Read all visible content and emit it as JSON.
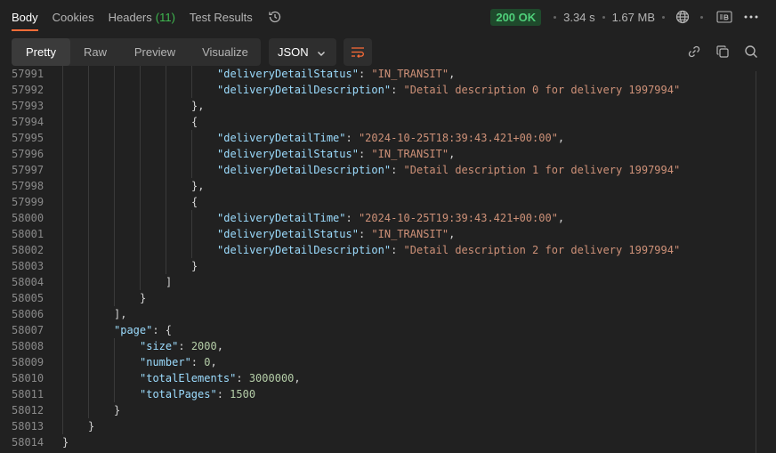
{
  "tabs": [
    {
      "label": "Body",
      "active": true
    },
    {
      "label": "Cookies",
      "active": false
    },
    {
      "label": "Headers",
      "count": "(11)",
      "active": false
    },
    {
      "label": "Test Results",
      "active": false
    }
  ],
  "status": {
    "code": "200 OK",
    "time": "3.34 s",
    "size": "1.67 MB"
  },
  "view_modes": [
    "Pretty",
    "Raw",
    "Preview",
    "Visualize"
  ],
  "format": "JSON",
  "colors": {
    "accent": "#ff6c37",
    "ok": "#4fd07a",
    "key": "#9cdcfe",
    "string": "#ce9178",
    "number": "#b5cea8"
  },
  "lines": [
    {
      "n": "57991",
      "indent": 6,
      "parts": [
        [
          "k",
          "\"deliveryDetailStatus\""
        ],
        [
          "p",
          ": "
        ],
        [
          "s",
          "\"IN_TRANSIT\""
        ],
        [
          "p",
          ","
        ]
      ]
    },
    {
      "n": "57992",
      "indent": 6,
      "parts": [
        [
          "k",
          "\"deliveryDetailDescription\""
        ],
        [
          "p",
          ": "
        ],
        [
          "s",
          "\"Detail description 0 for delivery 1997994\""
        ]
      ]
    },
    {
      "n": "57993",
      "indent": 5,
      "parts": [
        [
          "p",
          "},"
        ]
      ]
    },
    {
      "n": "57994",
      "indent": 5,
      "parts": [
        [
          "p",
          "{"
        ]
      ]
    },
    {
      "n": "57995",
      "indent": 6,
      "parts": [
        [
          "k",
          "\"deliveryDetailTime\""
        ],
        [
          "p",
          ": "
        ],
        [
          "s",
          "\"2024-10-25T18:39:43.421+00:00\""
        ],
        [
          "p",
          ","
        ]
      ]
    },
    {
      "n": "57996",
      "indent": 6,
      "parts": [
        [
          "k",
          "\"deliveryDetailStatus\""
        ],
        [
          "p",
          ": "
        ],
        [
          "s",
          "\"IN_TRANSIT\""
        ],
        [
          "p",
          ","
        ]
      ]
    },
    {
      "n": "57997",
      "indent": 6,
      "parts": [
        [
          "k",
          "\"deliveryDetailDescription\""
        ],
        [
          "p",
          ": "
        ],
        [
          "s",
          "\"Detail description 1 for delivery 1997994\""
        ]
      ]
    },
    {
      "n": "57998",
      "indent": 5,
      "parts": [
        [
          "p",
          "},"
        ]
      ]
    },
    {
      "n": "57999",
      "indent": 5,
      "parts": [
        [
          "p",
          "{"
        ]
      ]
    },
    {
      "n": "58000",
      "indent": 6,
      "parts": [
        [
          "k",
          "\"deliveryDetailTime\""
        ],
        [
          "p",
          ": "
        ],
        [
          "s",
          "\"2024-10-25T19:39:43.421+00:00\""
        ],
        [
          "p",
          ","
        ]
      ]
    },
    {
      "n": "58001",
      "indent": 6,
      "parts": [
        [
          "k",
          "\"deliveryDetailStatus\""
        ],
        [
          "p",
          ": "
        ],
        [
          "s",
          "\"IN_TRANSIT\""
        ],
        [
          "p",
          ","
        ]
      ]
    },
    {
      "n": "58002",
      "indent": 6,
      "parts": [
        [
          "k",
          "\"deliveryDetailDescription\""
        ],
        [
          "p",
          ": "
        ],
        [
          "s",
          "\"Detail description 2 for delivery 1997994\""
        ]
      ]
    },
    {
      "n": "58003",
      "indent": 5,
      "parts": [
        [
          "p",
          "}"
        ]
      ]
    },
    {
      "n": "58004",
      "indent": 4,
      "parts": [
        [
          "p",
          "]"
        ]
      ]
    },
    {
      "n": "58005",
      "indent": 3,
      "parts": [
        [
          "p",
          "}"
        ]
      ]
    },
    {
      "n": "58006",
      "indent": 2,
      "parts": [
        [
          "p",
          "],"
        ]
      ]
    },
    {
      "n": "58007",
      "indent": 2,
      "parts": [
        [
          "k",
          "\"page\""
        ],
        [
          "p",
          ": {"
        ]
      ]
    },
    {
      "n": "58008",
      "indent": 3,
      "parts": [
        [
          "k",
          "\"size\""
        ],
        [
          "p",
          ": "
        ],
        [
          "n",
          "2000"
        ],
        [
          "p",
          ","
        ]
      ]
    },
    {
      "n": "58009",
      "indent": 3,
      "parts": [
        [
          "k",
          "\"number\""
        ],
        [
          "p",
          ": "
        ],
        [
          "n",
          "0"
        ],
        [
          "p",
          ","
        ]
      ]
    },
    {
      "n": "58010",
      "indent": 3,
      "parts": [
        [
          "k",
          "\"totalElements\""
        ],
        [
          "p",
          ": "
        ],
        [
          "n",
          "3000000"
        ],
        [
          "p",
          ","
        ]
      ]
    },
    {
      "n": "58011",
      "indent": 3,
      "parts": [
        [
          "k",
          "\"totalPages\""
        ],
        [
          "p",
          ": "
        ],
        [
          "n",
          "1500"
        ]
      ]
    },
    {
      "n": "58012",
      "indent": 2,
      "parts": [
        [
          "p",
          "}"
        ]
      ]
    },
    {
      "n": "58013",
      "indent": 1,
      "parts": [
        [
          "p",
          "}"
        ]
      ]
    },
    {
      "n": "58014",
      "indent": 0,
      "parts": [
        [
          "p",
          "}"
        ]
      ]
    }
  ]
}
